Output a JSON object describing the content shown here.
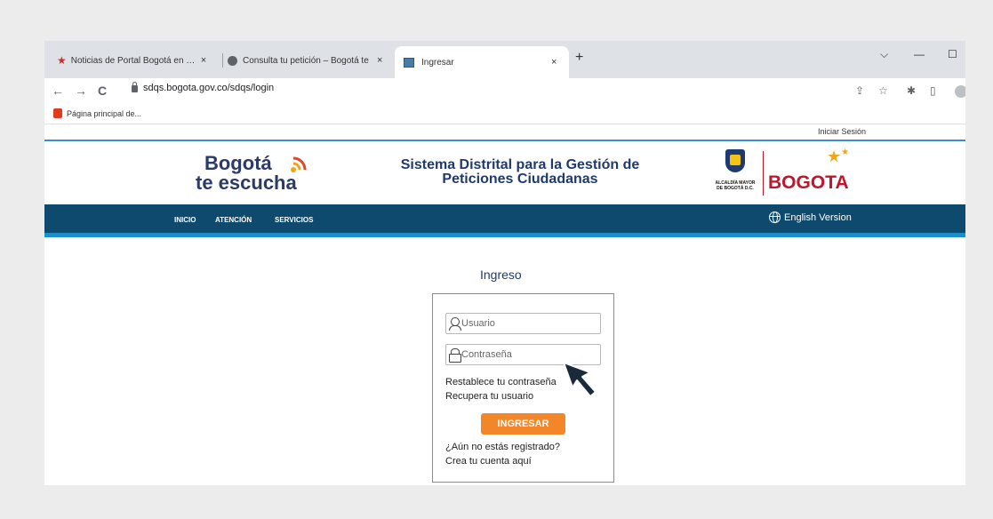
{
  "browser": {
    "tabs": [
      {
        "title": "Noticias de Portal Bogotá en Bog"
      },
      {
        "title": "Consulta tu petición – Bogotá te"
      },
      {
        "title": "Ingresar"
      }
    ],
    "tab_close": "×",
    "new_tab": "+",
    "window_controls": {
      "menu": "⌵",
      "minimize": "—",
      "maximize": "☐"
    },
    "url": "sdqs.bogota.gov.co/sdqs/login",
    "bookmark": "Página principal de..."
  },
  "site": {
    "login_link": "Iniciar Sesión",
    "logo_line1": "Bogotá",
    "logo_line2": "te escucha",
    "title_line1": "Sistema Distrital para la Gestión de",
    "title_line2": "Peticiones Ciudadanas",
    "alcaldia_line1": "ALCALDÍA MAYOR",
    "alcaldia_line2": "DE BOGOTÁ D.C.",
    "bogota_logo": "BOGOTA",
    "nav": [
      "INICIO",
      "ATENCIÓN",
      "SERVICIOS"
    ],
    "english": "English Version"
  },
  "login": {
    "heading": "Ingreso",
    "user_placeholder": "Usuario",
    "password_placeholder": "Contraseña",
    "reset_password": "Restablece tu contraseña",
    "recover_user": "Recupera tu usuario",
    "submit": "INGRESAR",
    "not_registered": "¿Aún no estás registrado?",
    "create_account": "Crea tu cuenta aquí"
  },
  "colors": {
    "nav_bg": "#0d4a6e",
    "nav_stripe": "#1b8fc9",
    "button": "#f4862a",
    "brand_red": "#c0152b",
    "title_blue": "#1e3a6e"
  }
}
